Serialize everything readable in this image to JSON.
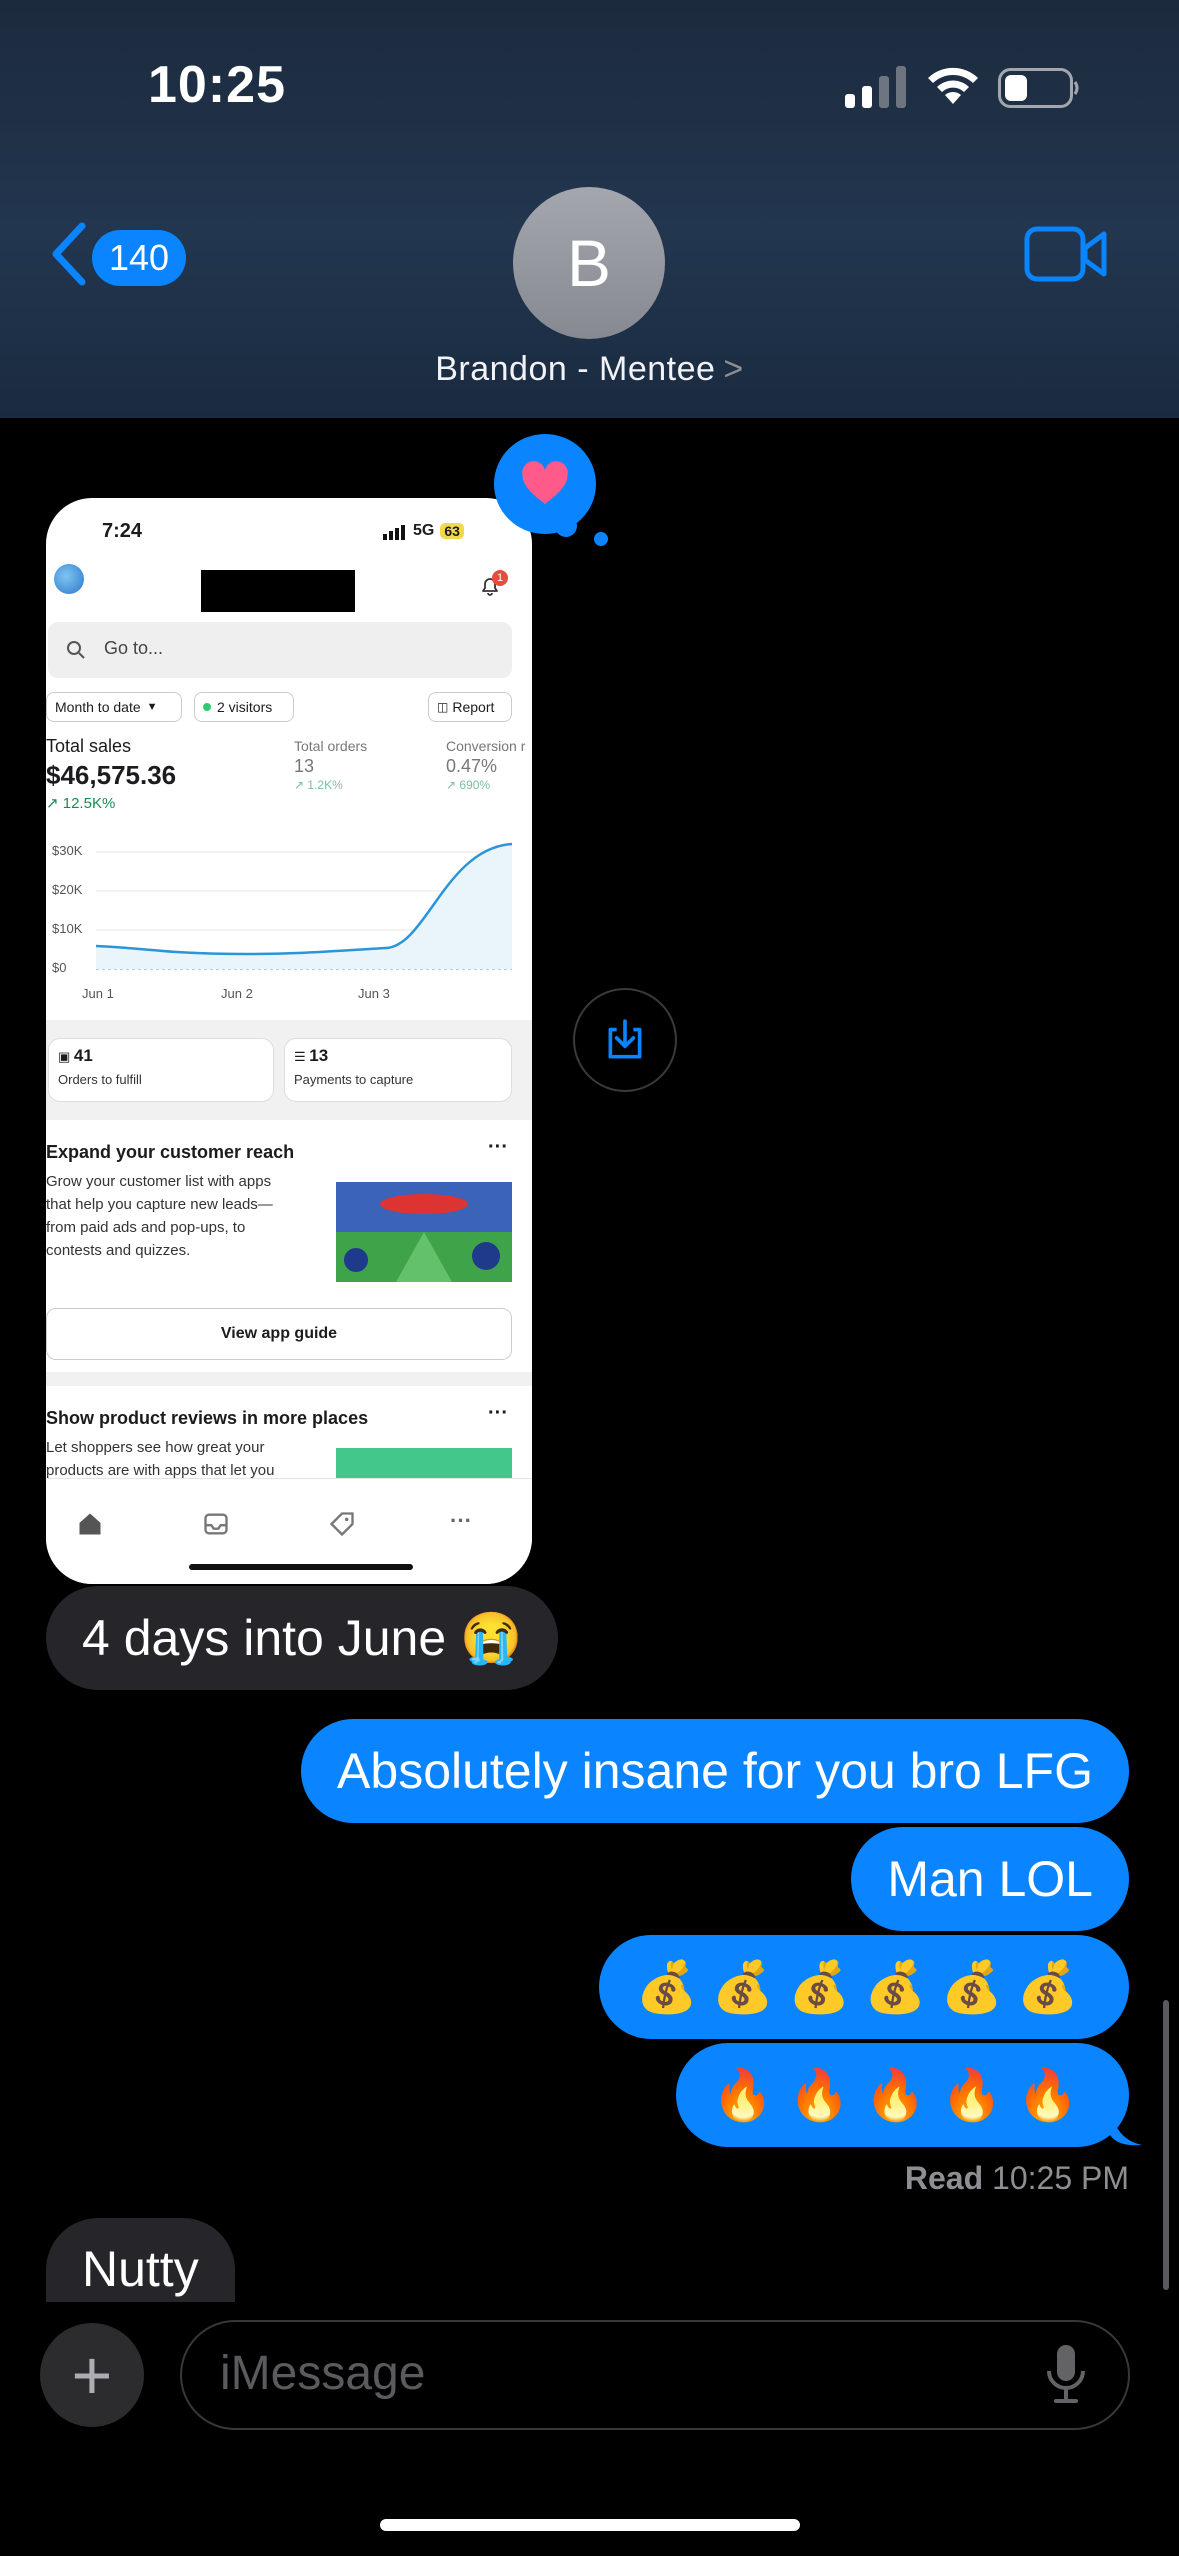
{
  "status_bar": {
    "time": "10:25"
  },
  "header": {
    "back_count": "140",
    "avatar_initial": "B",
    "contact_name": "Brandon - Mentee",
    "contact_chevron": ">"
  },
  "attachment": {
    "status_time": "7:24",
    "network": "5G",
    "battery": "63",
    "notif_count": "1",
    "search_placeholder": "Go to...",
    "chip_date": "Month to date",
    "chip_visitors": "2 visitors",
    "chip_report": "Report",
    "kpis": {
      "sales_label": "Total sales",
      "sales_value": "$46,575.36",
      "sales_change": "12.5K%",
      "orders_label": "Total orders",
      "orders_value": "13",
      "orders_change": "1.2K%",
      "conv_label": "Conversion r",
      "conv_value": "0.47%",
      "conv_change": "690%"
    },
    "chart": {
      "y_ticks": [
        "$30K",
        "$20K",
        "$10K",
        "$0"
      ],
      "x_ticks": [
        "Jun 1",
        "Jun 2",
        "Jun 3"
      ]
    },
    "cards": [
      {
        "value": "41",
        "label": "Orders to fulfill"
      },
      {
        "value": "13",
        "label": "Payments to capture"
      }
    ],
    "section1": {
      "title": "Expand your customer reach",
      "more": "···",
      "body": [
        "Grow your customer list with apps",
        "that help you capture new leads—",
        "from paid ads and pop-ups, to",
        "contests and quizzes."
      ],
      "button": "View app guide"
    },
    "section2": {
      "title": "Show product reviews in more places",
      "more": "···",
      "body": [
        "Let shoppers see how great your",
        "products are with apps that let you"
      ]
    },
    "tab_more": "···"
  },
  "messages": [
    {
      "side": "received",
      "text": "4 days into June 😭"
    },
    {
      "side": "sent",
      "text": "Absolutely insane for you bro LFG"
    },
    {
      "side": "sent",
      "text": "Man LOL"
    },
    {
      "side": "sent",
      "text": "💰💰💰💰💰💰"
    },
    {
      "side": "sent",
      "text": "🔥🔥🔥🔥🔥"
    },
    {
      "side": "received",
      "text": "Nutty"
    }
  ],
  "read_receipt": {
    "label": "Read",
    "time": "10:25 PM"
  },
  "composer": {
    "placeholder": "iMessage",
    "plus": "+"
  },
  "colors": {
    "accent": "#0a84ff",
    "received_bubble": "#26252a",
    "reaction_heart": "#ff5a8a"
  },
  "icons": [
    "signal-icon",
    "wifi-icon",
    "battery-icon",
    "back-chevron-icon",
    "video-camera-icon",
    "heart-reaction-icon",
    "save-download-icon",
    "microphone-icon"
  ]
}
